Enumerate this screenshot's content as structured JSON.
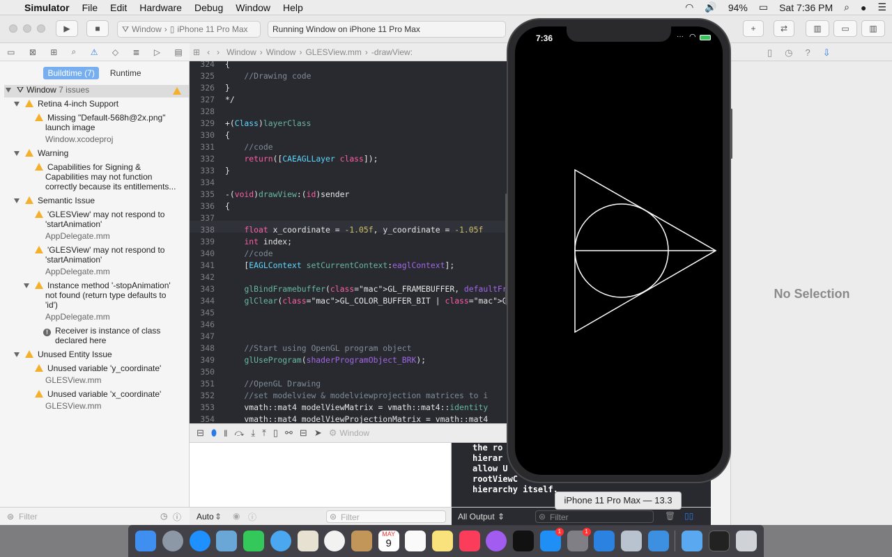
{
  "menubar": {
    "app_name": "Simulator",
    "items": [
      "File",
      "Edit",
      "Hardware",
      "Debug",
      "Window",
      "Help"
    ],
    "battery": "94%",
    "clock": "Sat 7:36 PM"
  },
  "toolbar": {
    "scheme": "Window",
    "destination": "iPhone 11 Pro Max",
    "status": "Running Window on iPhone 11 Pro Max"
  },
  "issue_tabs": {
    "buildtime": "Buildtime (7)",
    "runtime": "Runtime"
  },
  "issues": {
    "project": "Window",
    "project_count": "7 issues",
    "groups": [
      {
        "title": "Retina 4-inch Support",
        "items": [
          {
            "l1": "Missing \"Default-568h@2x.png\"",
            "l2": "launch image",
            "file": "Window.xcodeproj"
          }
        ]
      },
      {
        "title": "Warning",
        "items": [
          {
            "l1": "Capabilities for Signing &",
            "l2": "Capabilities may not function",
            "l3": "correctly because its entitlements..."
          }
        ]
      },
      {
        "title": "Semantic Issue",
        "items": [
          {
            "l1": "'GLESView' may not respond to",
            "l2": "'startAnimation'",
            "file": "AppDelegate.mm"
          },
          {
            "l1": "'GLESView' may not respond to",
            "l2": "'startAnimation'",
            "file": "AppDelegate.mm"
          },
          {
            "l1": "Instance method '-stopAnimation'",
            "l2": "not found (return type defaults to",
            "l3": "'id')",
            "file": "AppDelegate.mm"
          },
          {
            "l1": "Receiver is instance of class",
            "l2": "declared here"
          }
        ]
      },
      {
        "title": "Unused Entity Issue",
        "items": [
          {
            "l1": "Unused variable 'y_coordinate'",
            "file": "GLESView.mm"
          },
          {
            "l1": "Unused variable 'x_coordinate'",
            "file": "GLESView.mm"
          }
        ]
      }
    ],
    "filter_placeholder": "Filter"
  },
  "jumpbar": [
    "Window",
    "Window",
    "GLESView.mm",
    "-drawView:"
  ],
  "editor": {
    "lines": [
      {
        "n": "324",
        "t": "{"
      },
      {
        "n": "325",
        "t": "    //Drawing code"
      },
      {
        "n": "326",
        "t": "}"
      },
      {
        "n": "327",
        "t": "*/"
      },
      {
        "n": "328",
        "t": ""
      },
      {
        "n": "329",
        "t": "+(Class)layerClass"
      },
      {
        "n": "330",
        "t": "{"
      },
      {
        "n": "331",
        "t": "    //code"
      },
      {
        "n": "332",
        "t": "    return([CAEAGLLayer class]);"
      },
      {
        "n": "333",
        "t": "}"
      },
      {
        "n": "334",
        "t": ""
      },
      {
        "n": "335",
        "t": "-(void)drawView:(id)sender"
      },
      {
        "n": "336",
        "t": "{"
      },
      {
        "n": "337",
        "t": ""
      },
      {
        "n": "338",
        "t": "    float x_coordinate = -1.05f, y_coordinate = -1.05f"
      },
      {
        "n": "339",
        "t": "    int index;"
      },
      {
        "n": "340",
        "t": "    //code"
      },
      {
        "n": "341",
        "t": "    [EAGLContext setCurrentContext:eaglContext];"
      },
      {
        "n": "342",
        "t": ""
      },
      {
        "n": "343",
        "t": "    glBindFramebuffer(GL_FRAMEBUFFER, defaultFramebuffe"
      },
      {
        "n": "344",
        "t": "    glClear(GL_COLOR_BUFFER_BIT | GL_DEPTH_BUFFER_BIT"
      },
      {
        "n": "345",
        "t": ""
      },
      {
        "n": "346",
        "t": ""
      },
      {
        "n": "347",
        "t": ""
      },
      {
        "n": "348",
        "t": "    //Start using OpenGL program object"
      },
      {
        "n": "349",
        "t": "    glUseProgram(shaderProgramObject_BRK);"
      },
      {
        "n": "350",
        "t": ""
      },
      {
        "n": "351",
        "t": "    //OpenGL Drawing"
      },
      {
        "n": "352",
        "t": "    //set modelview & modelviewprojection matrices to i"
      },
      {
        "n": "353",
        "t": "    vmath::mat4 modelViewMatrix = vmath::mat4::identity"
      },
      {
        "n": "354",
        "t": "    vmath::mat4 modelViewProjectionMatrix = vmath::mat4"
      }
    ]
  },
  "debugbar": {
    "target": "Window"
  },
  "debug_area": {
    "auto_label": "Auto",
    "filter_placeholder": "Filter",
    "output_label": "All Output",
    "console_filter_placeholder": "Filter",
    "console_lines": [
      "the ro",
      "hierar",
      "allow U",
      "rootViewC",
      "hierarchy itself."
    ]
  },
  "inspector": {
    "empty_label": "No Selection"
  },
  "simulator": {
    "time": "7:36",
    "tooltip": "iPhone 11 Pro Max — 13.3"
  },
  "dock": {
    "calendar_month": "MAY",
    "calendar_day": "9",
    "appstore_badge": "1",
    "prefs_badge": "1"
  }
}
